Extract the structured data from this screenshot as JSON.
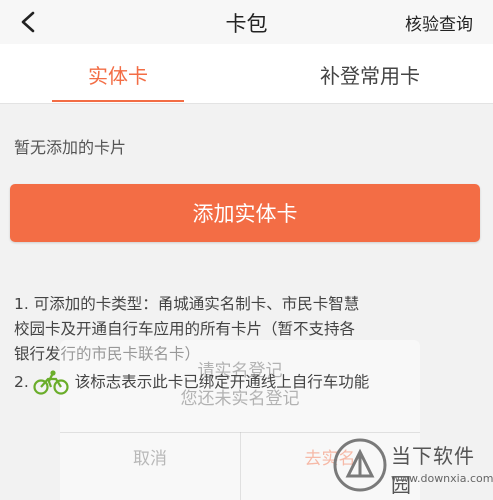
{
  "header": {
    "title": "卡包",
    "right_action": "核验查询",
    "back_icon": "chevron-left-icon"
  },
  "tabs": [
    {
      "label": "实体卡",
      "active": true
    },
    {
      "label": "补登常用卡",
      "active": false
    }
  ],
  "accent_color": "#f36d45",
  "main": {
    "empty_text": "暂无添加的卡片",
    "add_button_label": "添加实体卡",
    "note1_line1": "1. 可添加的卡类型：甬城通实名制卡、市民卡智慧",
    "note1_line2": "校园卡及开通自行车应用的所有卡片（暂不支持各",
    "note1_line3": "银行发行的市民卡联名卡）",
    "note2_prefix": "2.",
    "note2_icon": "bicycle-icon",
    "note2_text": "该标志表示此卡已绑定开通线上自行车功能"
  },
  "dialog": {
    "title": "请实名登记",
    "message": "您还未实名登记",
    "cancel_label": "取消",
    "confirm_label": "去实名"
  },
  "watermark": {
    "name": "当下软件园",
    "url": "www.downxia.com"
  }
}
